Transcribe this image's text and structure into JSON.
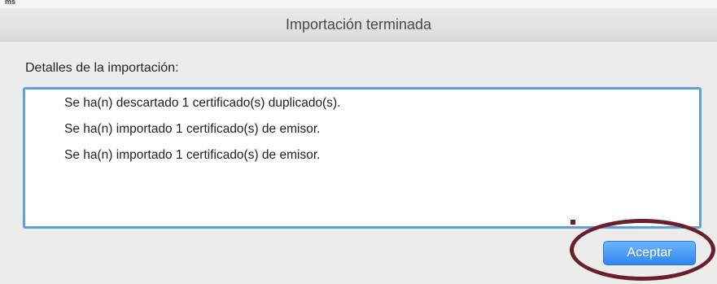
{
  "background_strip": {
    "fragment": "ms"
  },
  "dialog": {
    "title": "Importación terminada",
    "details_label": "Detalles de la importación:",
    "details_lines": [
      "Se ha(n) descartado 1 certificado(s) duplicado(s).",
      "Se ha(n) importado 1 certificado(s) de emisor.",
      "Se ha(n) importado 1 certificado(s) de emisor."
    ],
    "accept_label": "Aceptar"
  },
  "colors": {
    "accent": "#2f87f3",
    "focus_ring": "#5fa0dc",
    "annotation": "#6b1e2b"
  }
}
